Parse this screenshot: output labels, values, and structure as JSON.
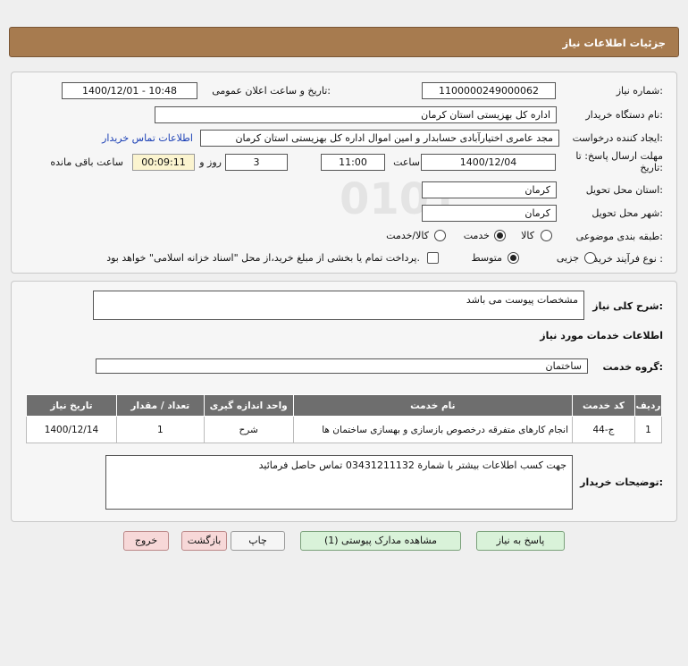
{
  "header": {
    "title": "جزئیات اطلاعات نیاز"
  },
  "form": {
    "need_number_label": "شماره نیاز:",
    "need_number": "1100000249000062",
    "announce_label": "تاریخ و ساعت اعلان عمومی:",
    "announce_value": "1400/12/01 - 10:48",
    "buyer_org_label": "نام دستگاه خریدار:",
    "buyer_org": "اداره کل بهزیستی استان کرمان",
    "creator_label": "ایجاد کننده درخواست:",
    "creator": "مجد عامری اختیارآبادی حسابدار و امین اموال اداره کل بهزیستی استان کرمان",
    "contact_link": "اطلاعات تماس خریدار",
    "deadline_label_1": "مهلت ارسال پاسخ: تا",
    "deadline_label_2": "تاریخ:",
    "deadline_date": "1400/12/04",
    "time_label": "ساعت",
    "deadline_time": "11:00",
    "days_value": "3",
    "days_label": "روز و",
    "remaining_time": "00:09:11",
    "remaining_label": "ساعت باقی مانده",
    "province_label": "استان محل تحویل:",
    "province": "کرمان",
    "city_label": "شهر محل تحویل:",
    "city": "کرمان",
    "category_label": "طبقه بندی موضوعی:",
    "category_options": [
      "کالا",
      "خدمت",
      "کالا/خدمت"
    ],
    "category_selected": "خدمت",
    "process_label": "نوع فرآیند خرید :",
    "process_options": [
      "جزیی",
      "متوسط"
    ],
    "process_selected": "متوسط",
    "treasury_note": "پرداخت تمام یا بخشی از مبلغ خرید،از محل \"اسناد خزانه اسلامی\" خواهد بود."
  },
  "description": {
    "label": "شرح کلی نیاز:",
    "value": "مشخصات پیوست می باشد",
    "services_title": "اطلاعات خدمات مورد نیاز",
    "service_group_label": "گروه خدمت:",
    "service_group": "ساختمان"
  },
  "table": {
    "headers": [
      "ردیف",
      "کد خدمت",
      "نام خدمت",
      "واحد اندازه گیری",
      "تعداد / مقدار",
      "تاریخ نیاز"
    ],
    "rows": [
      [
        "1",
        "ج-44",
        "انجام کارهای متفرقه درخصوص بازسازی و بهسازی ساختمان ها",
        "شرح",
        "1",
        "1400/12/14"
      ]
    ]
  },
  "buyer_notes": {
    "label": "توضیحات خریدار:",
    "value": "جهت کسب اطلاعات بیشتر با شمارة 03431211132 تماس حاصل فرمائید"
  },
  "buttons": {
    "reply": "پاسخ به نیاز",
    "attachments": "مشاهده مدارک پیوستی (1)",
    "print": "چاپ",
    "back": "بازگشت",
    "exit": "خروج"
  }
}
